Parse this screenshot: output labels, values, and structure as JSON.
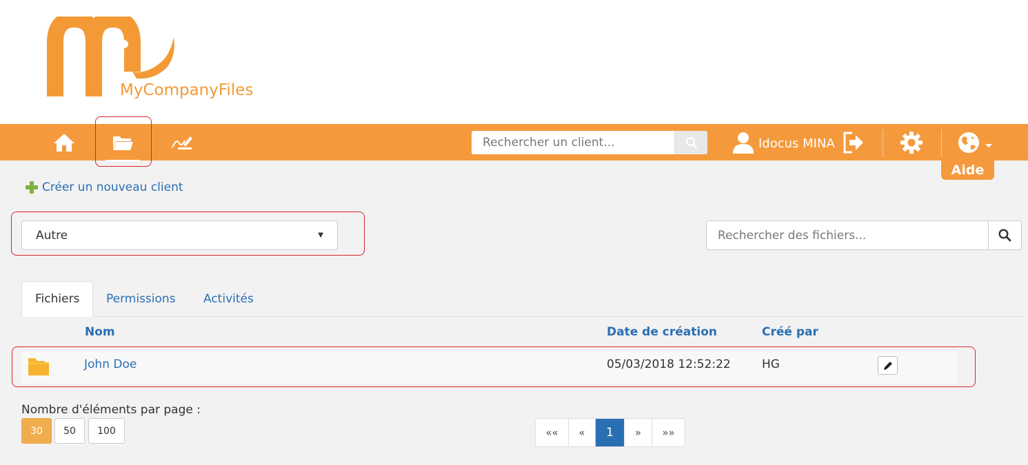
{
  "brand": {
    "name": "MyCompanyFiles",
    "color": "#f39a36"
  },
  "navbar": {
    "color": "#f59a3c",
    "items": [
      {
        "name": "home",
        "icon": "home-icon"
      },
      {
        "name": "files",
        "icon": "folder-open-icon",
        "active": true
      },
      {
        "name": "signature",
        "icon": "signature-icon"
      }
    ],
    "client_search_placeholder": "Rechercher un client...",
    "user_name": "Idocus MINA",
    "help_label": "Aide"
  },
  "actions": {
    "new_client": "Créer un nouveau client"
  },
  "filter": {
    "selected": "Autre"
  },
  "file_search": {
    "placeholder": "Rechercher des fichiers..."
  },
  "tabs": [
    {
      "label": "Fichiers",
      "active": true
    },
    {
      "label": "Permissions"
    },
    {
      "label": "Activités"
    }
  ],
  "table": {
    "columns": [
      "Nom",
      "Date de création",
      "Créé par"
    ],
    "rows": [
      {
        "name": "John Doe",
        "created": "05/03/2018 12:52:22",
        "by": "HG",
        "icon": "folder-icon"
      }
    ]
  },
  "pagination": {
    "per_page_label": "Nombre d'éléments par page :",
    "sizes": [
      "30",
      "50",
      "100"
    ],
    "selected_size": "30",
    "first": "««",
    "prev": "«",
    "current": "1",
    "next": "»",
    "last": "»»"
  }
}
